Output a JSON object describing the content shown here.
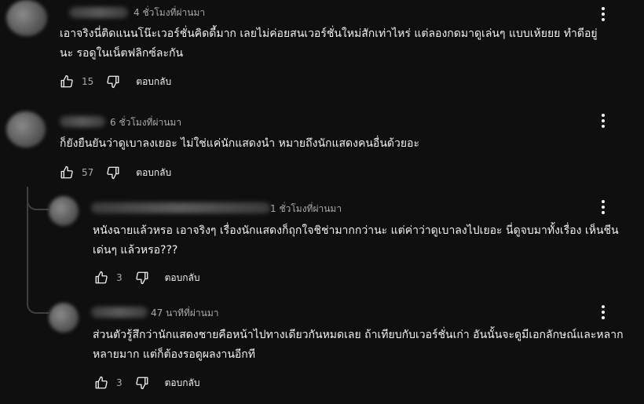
{
  "comments": [
    {
      "time": "4 ชั่วโมงที่ผ่านมา",
      "text": "เอาจริงนี่ติดแนนโน๊ะเวอร์ชั่นคิดดี้มาก เลยไม่ค่อยสนเวอร์ชั่นใหม่สักเท่าไหร่ แต่ลองกดมาดูเล่นๆ แบบเห้ยยย ทำดีอยู่นะ รอดูในเน็ตฟลิกซ์ละกัน",
      "likes": "15",
      "reply_label": "ตอบกลับ"
    },
    {
      "time": "6 ชั่วโมงที่ผ่านมา",
      "text": "ก็ยังยืนยันว่าดูเบาลงเยอะ ไม่ใช่แค่นักแสดงนำ หมายถึงนักแสดงคนอื่นด้วยอะ",
      "likes": "57",
      "reply_label": "ตอบกลับ"
    },
    {
      "time": "1 ชั่วโมงที่ผ่านมา",
      "text": "หนังฉายแล้วหรอ เอาจริงๆ เรื่องนักแสดงก็ถุกใจชิช่ามากกว่านะ แต่ค่าว่าดูเบาลงไปเยอะ นี่ดูจบมาทั้งเรื่อง เห็นชีนเด่นๆ แล้วหรอ???",
      "likes": "3",
      "reply_label": "ตอบกลับ"
    },
    {
      "time": "47 นาทีที่ผ่านมา",
      "text": "ส่วนตัวรู้สึกว่านักแสดงชายคือหน้าไปทางเดียวกันหมดเลย ถ้าเทียบกับเวอร์ชั่นเก่า อันนั้นจะดูมีเอกลักษณ์และหลากหลายมาก แต่ก็ต้องรอดูผลงานอีกที",
      "likes": "3",
      "reply_label": "ตอบกลับ"
    }
  ],
  "icons": {
    "like": "thumb-up-icon",
    "dislike": "thumb-down-icon",
    "more": "more-vert-icon"
  },
  "colors": {
    "background": "#0f0f0f",
    "text": "#f1f1f1",
    "secondary": "#aaaaaa"
  }
}
